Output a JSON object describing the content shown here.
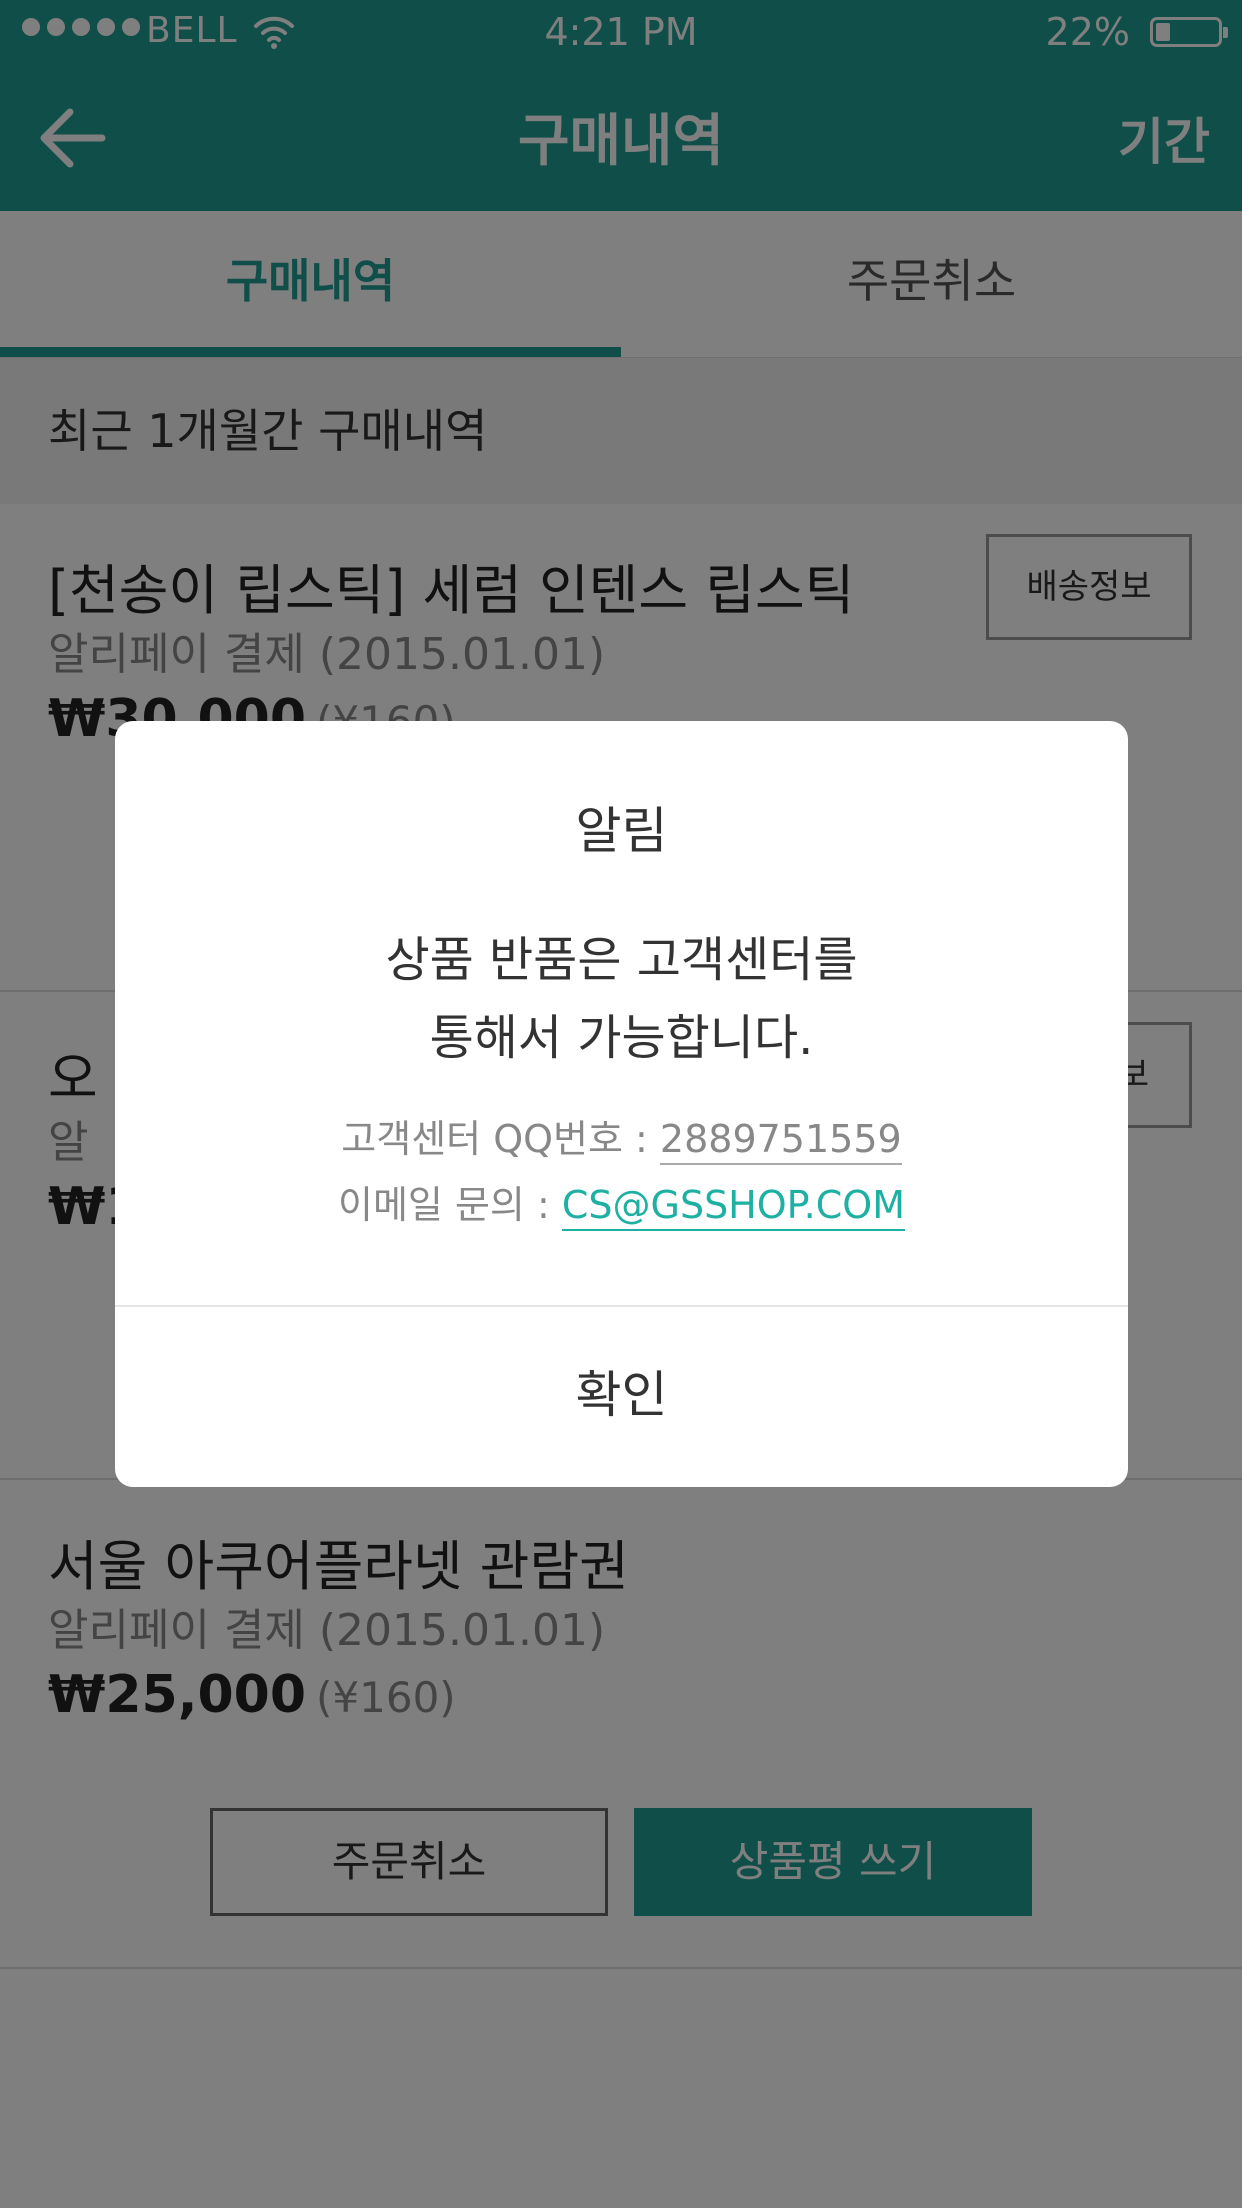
{
  "status_bar": {
    "carrier": "BELL",
    "time": "4:21 PM",
    "battery_percent": "22%"
  },
  "nav": {
    "title": "구매내역",
    "right_label": "기간"
  },
  "tabs": [
    {
      "label": "구매내역",
      "active": true
    },
    {
      "label": "주문취소",
      "active": false
    }
  ],
  "section_header": "최근 1개월간 구매내역",
  "orders": [
    {
      "name": "[천송이 립스틱] 세럼 인텐스 립스틱",
      "payment": "알리페이 결제  (2015.01.01)",
      "price": "₩30,000",
      "price_cny": "(¥160)",
      "shipping_button": "배송정보"
    },
    {
      "name": "오",
      "payment": "알",
      "price": "₩1",
      "price_cny": "",
      "shipping_button": "보"
    },
    {
      "name": "서울 아쿠어플라넷 관람권",
      "payment": "알리페이 결제  (2015.01.01)",
      "price": "₩25,000",
      "price_cny": "(¥160)"
    }
  ],
  "buttons": {
    "cancel_order": "주문취소",
    "write_review": "상품평 쓰기"
  },
  "dialog": {
    "title": "알림",
    "message_line1": "상품 반품은 고객센터를",
    "message_line2": "통해서 가능합니다.",
    "qq_label": "고객센터 QQ번호 : ",
    "qq_number": "2889751559",
    "email_label": "이메일 문의 : ",
    "email": "CS@GSSHOP.COM",
    "confirm": "확인"
  },
  "colors": {
    "brand": "#1f9c92",
    "link": "#1fb0a4"
  }
}
